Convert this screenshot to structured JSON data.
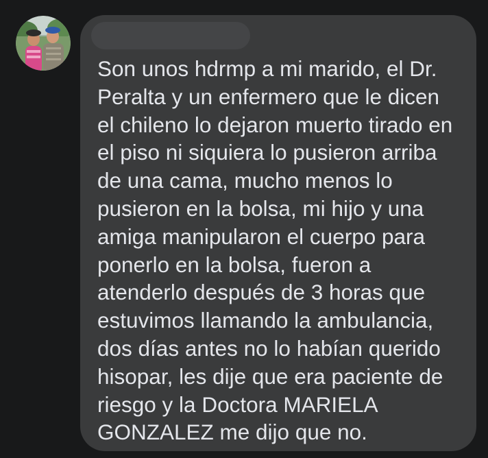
{
  "colors": {
    "background": "#18191a",
    "bubble": "#3a3b3c",
    "text": "#e4e6eb",
    "redaction": "#444547"
  },
  "avatar": {
    "icon": "profile-photo-avatar"
  },
  "message": {
    "text": "Son unos hdrmp a mi marido, el Dr.\nPeralta y un enfermero que le dicen\nel chileno lo dejaron muerto tirado en\nel piso ni siquiera lo pusieron arriba\nde una cama, mucho menos lo\npusieron en la bolsa, mi hijo y una\namiga manipularon el cuerpo para\nponerlo en la bolsa,  fueron a\natenderlo después de 3 horas que\nestuvimos llamando la ambulancia,\ndos días antes no lo habían querido\nhisopar, les dije que era paciente de\nriesgo y la Doctora MARIELA\nGONZALEZ me dijo que no."
  }
}
